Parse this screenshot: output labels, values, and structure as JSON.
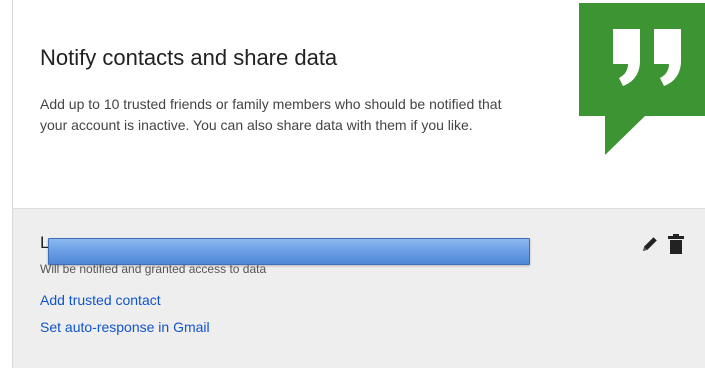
{
  "header": {
    "title": "Notify contacts and share data",
    "description": "Add up to 10 trusted friends or family members who should be notified that your account is inactive. You can also share data with them if you like."
  },
  "badge": {
    "icon": "quote-icon",
    "color": "#3d9432"
  },
  "contact": {
    "name": "L",
    "status": "Will be notified and granted access to data",
    "edit_icon": "pencil-icon",
    "delete_icon": "trash-icon"
  },
  "links": {
    "add_contact": "Add trusted contact",
    "auto_response": "Set auto-response in Gmail"
  },
  "colors": {
    "link": "#1155cc",
    "bottom_bg": "#eeeeee",
    "redaction": "#5b8fdc"
  }
}
